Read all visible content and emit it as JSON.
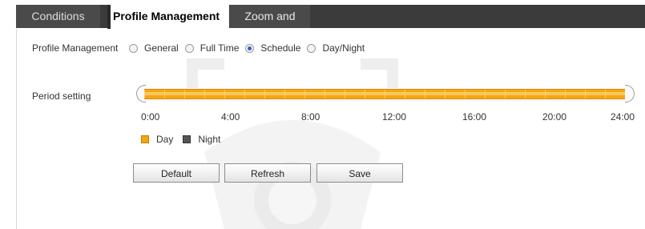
{
  "tabs": [
    {
      "label": "Conditions",
      "active": false
    },
    {
      "label": "Profile Management",
      "active": true
    },
    {
      "label": "Zoom and Focus",
      "active": false
    }
  ],
  "profile": {
    "label": "Profile Management",
    "options": [
      "General",
      "Full Time",
      "Schedule",
      "Day/Night"
    ],
    "selected": "Schedule"
  },
  "period": {
    "label": "Period setting",
    "ticks": [
      "0:00",
      "4:00",
      "8:00",
      "12:00",
      "16:00",
      "20:00",
      "24:00"
    ],
    "range_hours": [
      0,
      24
    ]
  },
  "legend": {
    "day": "Day",
    "night": "Night",
    "day_color": "#F5A416",
    "night_color": "#555555"
  },
  "buttons": {
    "default": "Default",
    "refresh": "Refresh",
    "save": "Save"
  }
}
